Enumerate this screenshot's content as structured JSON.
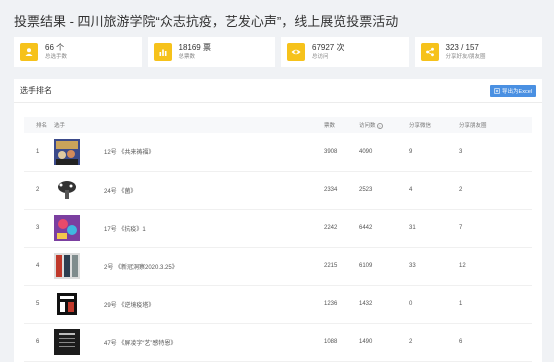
{
  "page_title": "投票结果 - 四川旅游学院“众志抗疫，艺发心声”，线上展览投票活动",
  "stats": [
    {
      "value": "66 个",
      "label": "总选手数",
      "icon": "user-icon"
    },
    {
      "value": "18169 票",
      "label": "总票数",
      "icon": "bar-chart-icon"
    },
    {
      "value": "67927 次",
      "label": "总访问",
      "icon": "eye-icon"
    },
    {
      "value": "323 / 157",
      "label": "分享好友/朋友圈",
      "icon": "share-icon"
    }
  ],
  "panel_title": "选手排名",
  "export_label": "导出为Excel",
  "columns": [
    "排名",
    "选手",
    "票数",
    "访问数",
    "分享微信",
    "分享朋友圈"
  ],
  "rows": [
    {
      "rank": "1",
      "name": "12号 《共来祷福》",
      "votes": "3908",
      "visits": "4090",
      "wechat": "9",
      "moments": "3"
    },
    {
      "rank": "2",
      "name": "24号 《菌》",
      "votes": "2334",
      "visits": "2523",
      "wechat": "4",
      "moments": "2"
    },
    {
      "rank": "3",
      "name": "17号 《抗疫》1",
      "votes": "2242",
      "visits": "6442",
      "wechat": "31",
      "moments": "7"
    },
    {
      "rank": "4",
      "name": "2号 《新冠洞察2020.3.25》",
      "votes": "2215",
      "visits": "6109",
      "wechat": "33",
      "moments": "12"
    },
    {
      "rank": "5",
      "name": "29号 《逆境疫塔》",
      "votes": "1236",
      "visits": "1432",
      "wechat": "0",
      "moments": "1"
    },
    {
      "rank": "6",
      "name": "47号 《屏凌字“艺”感特恩》",
      "votes": "1088",
      "visits": "1490",
      "wechat": "2",
      "moments": "6"
    }
  ],
  "colors": {
    "accent": "#f6c21b",
    "button": "#4a90e2"
  }
}
